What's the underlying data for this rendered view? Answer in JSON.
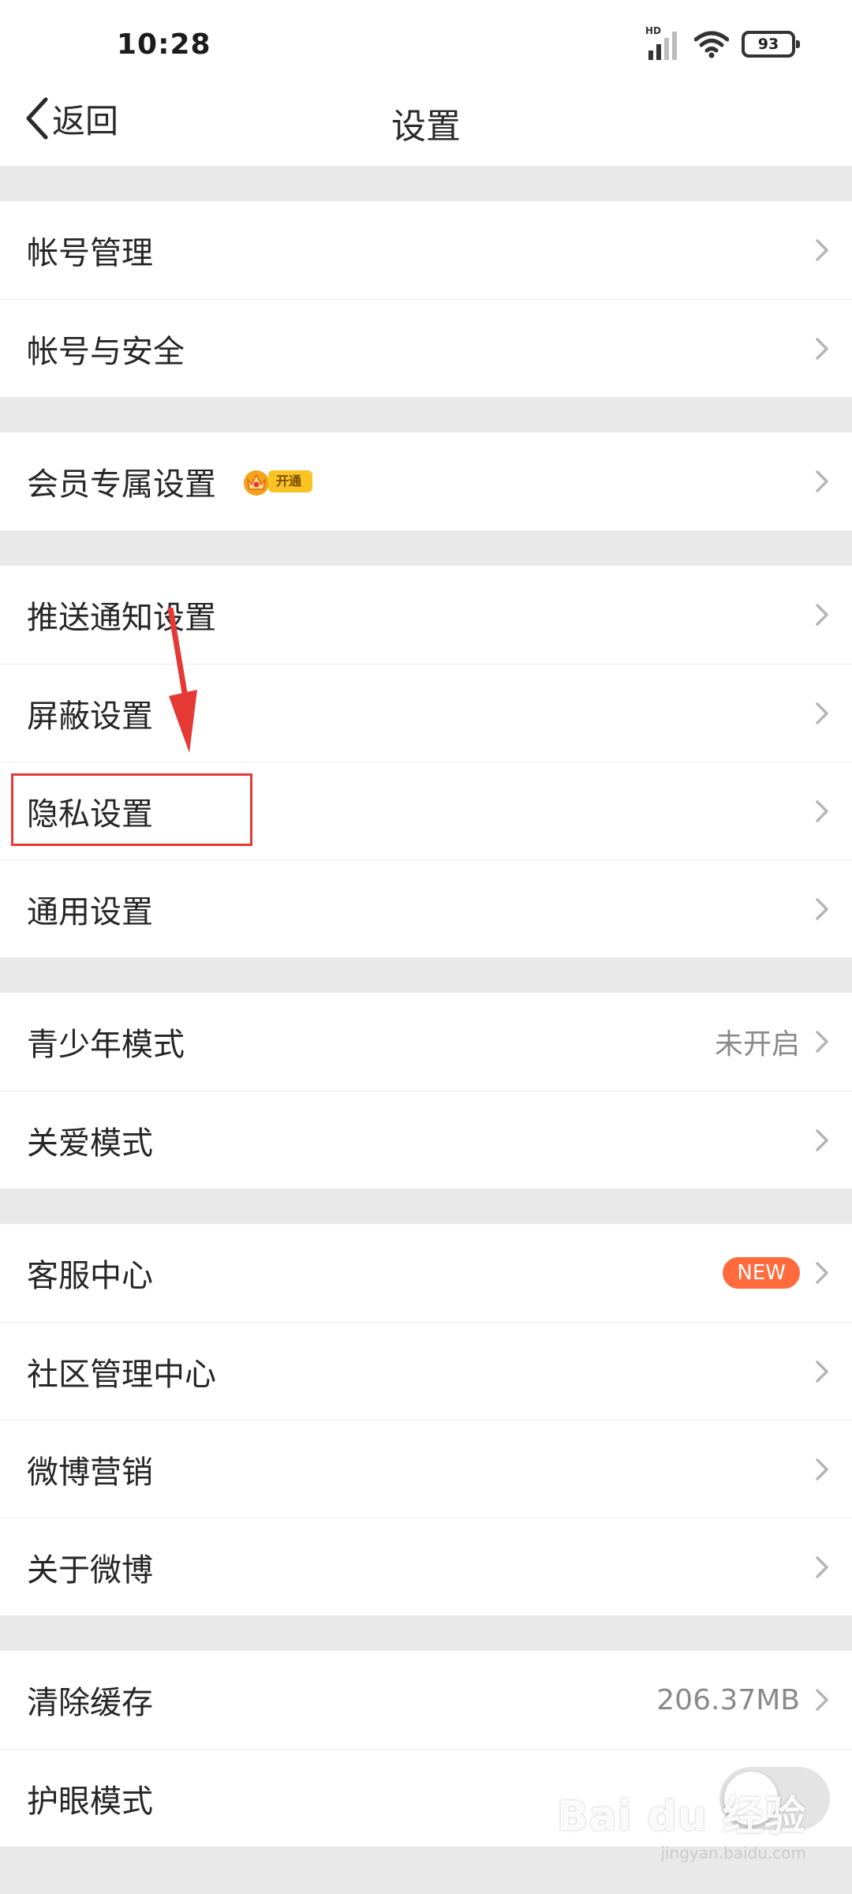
{
  "status_bar": {
    "time": "10:28",
    "network_label": "HD",
    "battery_level": "93"
  },
  "nav": {
    "back_label": "返回",
    "title": "设置"
  },
  "sections": [
    {
      "items": [
        {
          "label": "帐号管理"
        },
        {
          "label": "帐号与安全"
        }
      ]
    },
    {
      "items": [
        {
          "label": "会员专属设置",
          "badge": "开通"
        }
      ]
    },
    {
      "items": [
        {
          "label": "推送通知设置"
        },
        {
          "label": "屏蔽设置"
        },
        {
          "label": "隐私设置"
        },
        {
          "label": "通用设置"
        }
      ]
    },
    {
      "items": [
        {
          "label": "青少年模式",
          "value": "未开启"
        },
        {
          "label": "关爱模式"
        }
      ]
    },
    {
      "items": [
        {
          "label": "客服中心",
          "badge": "NEW"
        },
        {
          "label": "社区管理中心"
        },
        {
          "label": "微博营销"
        },
        {
          "label": "关于微博"
        }
      ]
    },
    {
      "items": [
        {
          "label": "清除缓存",
          "value": "206.37MB"
        },
        {
          "label": "护眼模式",
          "toggle_on": false
        }
      ]
    }
  ],
  "colors": {
    "background": "#e9e9e9",
    "row_background": "#ffffff",
    "new_badge": "#ff6b3d",
    "vip_badge": "#f8c323",
    "annotation": "#e53935"
  },
  "watermark": {
    "logo": "Bai du 经验",
    "url": "jingyan.baidu.com"
  }
}
